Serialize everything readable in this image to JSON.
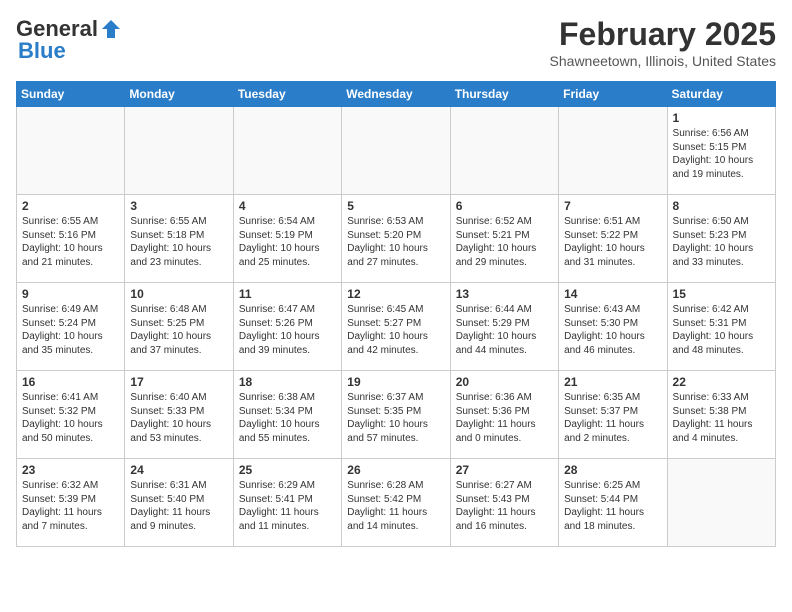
{
  "header": {
    "logo_general": "General",
    "logo_blue": "Blue",
    "month_title": "February 2025",
    "location": "Shawneetown, Illinois, United States"
  },
  "days_of_week": [
    "Sunday",
    "Monday",
    "Tuesday",
    "Wednesday",
    "Thursday",
    "Friday",
    "Saturday"
  ],
  "weeks": [
    [
      {
        "day": "",
        "info": ""
      },
      {
        "day": "",
        "info": ""
      },
      {
        "day": "",
        "info": ""
      },
      {
        "day": "",
        "info": ""
      },
      {
        "day": "",
        "info": ""
      },
      {
        "day": "",
        "info": ""
      },
      {
        "day": "1",
        "info": "Sunrise: 6:56 AM\nSunset: 5:15 PM\nDaylight: 10 hours and 19 minutes."
      }
    ],
    [
      {
        "day": "2",
        "info": "Sunrise: 6:55 AM\nSunset: 5:16 PM\nDaylight: 10 hours and 21 minutes."
      },
      {
        "day": "3",
        "info": "Sunrise: 6:55 AM\nSunset: 5:18 PM\nDaylight: 10 hours and 23 minutes."
      },
      {
        "day": "4",
        "info": "Sunrise: 6:54 AM\nSunset: 5:19 PM\nDaylight: 10 hours and 25 minutes."
      },
      {
        "day": "5",
        "info": "Sunrise: 6:53 AM\nSunset: 5:20 PM\nDaylight: 10 hours and 27 minutes."
      },
      {
        "day": "6",
        "info": "Sunrise: 6:52 AM\nSunset: 5:21 PM\nDaylight: 10 hours and 29 minutes."
      },
      {
        "day": "7",
        "info": "Sunrise: 6:51 AM\nSunset: 5:22 PM\nDaylight: 10 hours and 31 minutes."
      },
      {
        "day": "8",
        "info": "Sunrise: 6:50 AM\nSunset: 5:23 PM\nDaylight: 10 hours and 33 minutes."
      }
    ],
    [
      {
        "day": "9",
        "info": "Sunrise: 6:49 AM\nSunset: 5:24 PM\nDaylight: 10 hours and 35 minutes."
      },
      {
        "day": "10",
        "info": "Sunrise: 6:48 AM\nSunset: 5:25 PM\nDaylight: 10 hours and 37 minutes."
      },
      {
        "day": "11",
        "info": "Sunrise: 6:47 AM\nSunset: 5:26 PM\nDaylight: 10 hours and 39 minutes."
      },
      {
        "day": "12",
        "info": "Sunrise: 6:45 AM\nSunset: 5:27 PM\nDaylight: 10 hours and 42 minutes."
      },
      {
        "day": "13",
        "info": "Sunrise: 6:44 AM\nSunset: 5:29 PM\nDaylight: 10 hours and 44 minutes."
      },
      {
        "day": "14",
        "info": "Sunrise: 6:43 AM\nSunset: 5:30 PM\nDaylight: 10 hours and 46 minutes."
      },
      {
        "day": "15",
        "info": "Sunrise: 6:42 AM\nSunset: 5:31 PM\nDaylight: 10 hours and 48 minutes."
      }
    ],
    [
      {
        "day": "16",
        "info": "Sunrise: 6:41 AM\nSunset: 5:32 PM\nDaylight: 10 hours and 50 minutes."
      },
      {
        "day": "17",
        "info": "Sunrise: 6:40 AM\nSunset: 5:33 PM\nDaylight: 10 hours and 53 minutes."
      },
      {
        "day": "18",
        "info": "Sunrise: 6:38 AM\nSunset: 5:34 PM\nDaylight: 10 hours and 55 minutes."
      },
      {
        "day": "19",
        "info": "Sunrise: 6:37 AM\nSunset: 5:35 PM\nDaylight: 10 hours and 57 minutes."
      },
      {
        "day": "20",
        "info": "Sunrise: 6:36 AM\nSunset: 5:36 PM\nDaylight: 11 hours and 0 minutes."
      },
      {
        "day": "21",
        "info": "Sunrise: 6:35 AM\nSunset: 5:37 PM\nDaylight: 11 hours and 2 minutes."
      },
      {
        "day": "22",
        "info": "Sunrise: 6:33 AM\nSunset: 5:38 PM\nDaylight: 11 hours and 4 minutes."
      }
    ],
    [
      {
        "day": "23",
        "info": "Sunrise: 6:32 AM\nSunset: 5:39 PM\nDaylight: 11 hours and 7 minutes."
      },
      {
        "day": "24",
        "info": "Sunrise: 6:31 AM\nSunset: 5:40 PM\nDaylight: 11 hours and 9 minutes."
      },
      {
        "day": "25",
        "info": "Sunrise: 6:29 AM\nSunset: 5:41 PM\nDaylight: 11 hours and 11 minutes."
      },
      {
        "day": "26",
        "info": "Sunrise: 6:28 AM\nSunset: 5:42 PM\nDaylight: 11 hours and 14 minutes."
      },
      {
        "day": "27",
        "info": "Sunrise: 6:27 AM\nSunset: 5:43 PM\nDaylight: 11 hours and 16 minutes."
      },
      {
        "day": "28",
        "info": "Sunrise: 6:25 AM\nSunset: 5:44 PM\nDaylight: 11 hours and 18 minutes."
      },
      {
        "day": "",
        "info": ""
      }
    ]
  ]
}
